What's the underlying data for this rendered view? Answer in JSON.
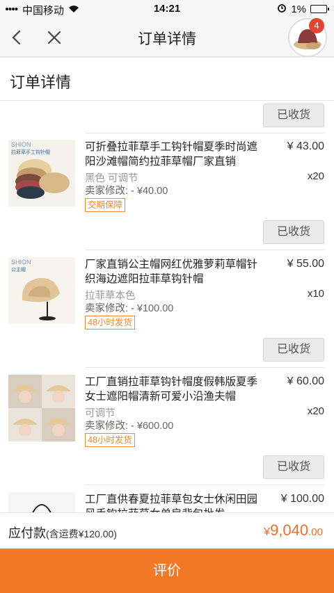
{
  "statusbar": {
    "carrier": "中国移动",
    "time": "14:21",
    "battery": "1%"
  },
  "navbar": {
    "title": "订单详情",
    "badge_count": "4"
  },
  "section": {
    "title": "订单详情"
  },
  "orders": [
    {
      "status_button": "已收货",
      "name": "可折叠拉菲草手工钩针帽夏季时尚遮阳沙滩帽简约拉菲草帽厂家直销",
      "price": "¥ 43.00",
      "qty": "x20",
      "spec": "黑色 可调节",
      "seller_price": "卖家修改: - ¥40.00",
      "tag": "交期保障",
      "thumb_caption": "拉菲草手工钩针帽",
      "thumb_brand": "SHION"
    },
    {
      "status_button": "已收货",
      "name": "厂家直销公主帽网红优雅萝莉草帽针织海边遮阳拉菲草钩针帽",
      "price": "¥ 55.00",
      "qty": "x10",
      "spec": "拉菲草本色",
      "seller_price": "卖家修改: - ¥100.00",
      "tag": "48小时发货",
      "thumb_caption": "公主帽",
      "thumb_brand": "SHION"
    },
    {
      "status_button": "已收货",
      "name": "工厂直销拉菲草钩针帽度假韩版夏季女士遮阳帽清新可爱小沿渔夫帽",
      "price": "¥ 60.00",
      "qty": "x20",
      "spec": "可调节",
      "seller_price": "卖家修改: - ¥600.00",
      "tag": "48小时发货"
    },
    {
      "status_button": "已收货",
      "name": "工厂直供春夏拉菲草包女士休闲田园风手钩拉菲草女单肩背包批发",
      "price": "¥ 100.00"
    }
  ],
  "footer": {
    "label": "应付款",
    "shipping_note": "(含运费¥120.00)",
    "currency": "¥",
    "amount_int": "9,040",
    "amount_dec": ".00",
    "review_button": "评价"
  },
  "colors": {
    "accent": "#f27a27",
    "price_orange": "#f0702a",
    "tag_orange": "#ef8a2f",
    "badge_red": "#e8432f"
  }
}
